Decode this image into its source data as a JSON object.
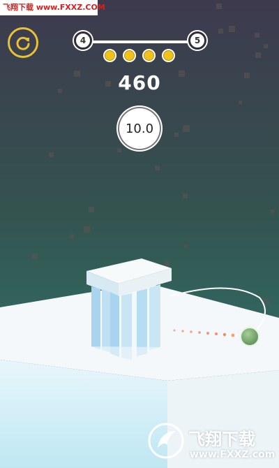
{
  "watermark_top": {
    "text": "飞翔下载 www.FXXZ.COM"
  },
  "hud": {
    "restart_icon": "restart-icon",
    "level_current": "4",
    "level_next": "5",
    "coins_collected": 4,
    "score": "460",
    "multiplier": "10.0"
  },
  "watermark_bottom": {
    "brand": "飞翔下载",
    "url": "www.FXXZ.com"
  },
  "colors": {
    "sky_top": "#3d3a4e",
    "sky_bottom": "#2f7e72",
    "coin": "#f0c21a",
    "restart_ring": "#e9c233",
    "ball": "#6fa468",
    "trail": "#f07a4a"
  }
}
